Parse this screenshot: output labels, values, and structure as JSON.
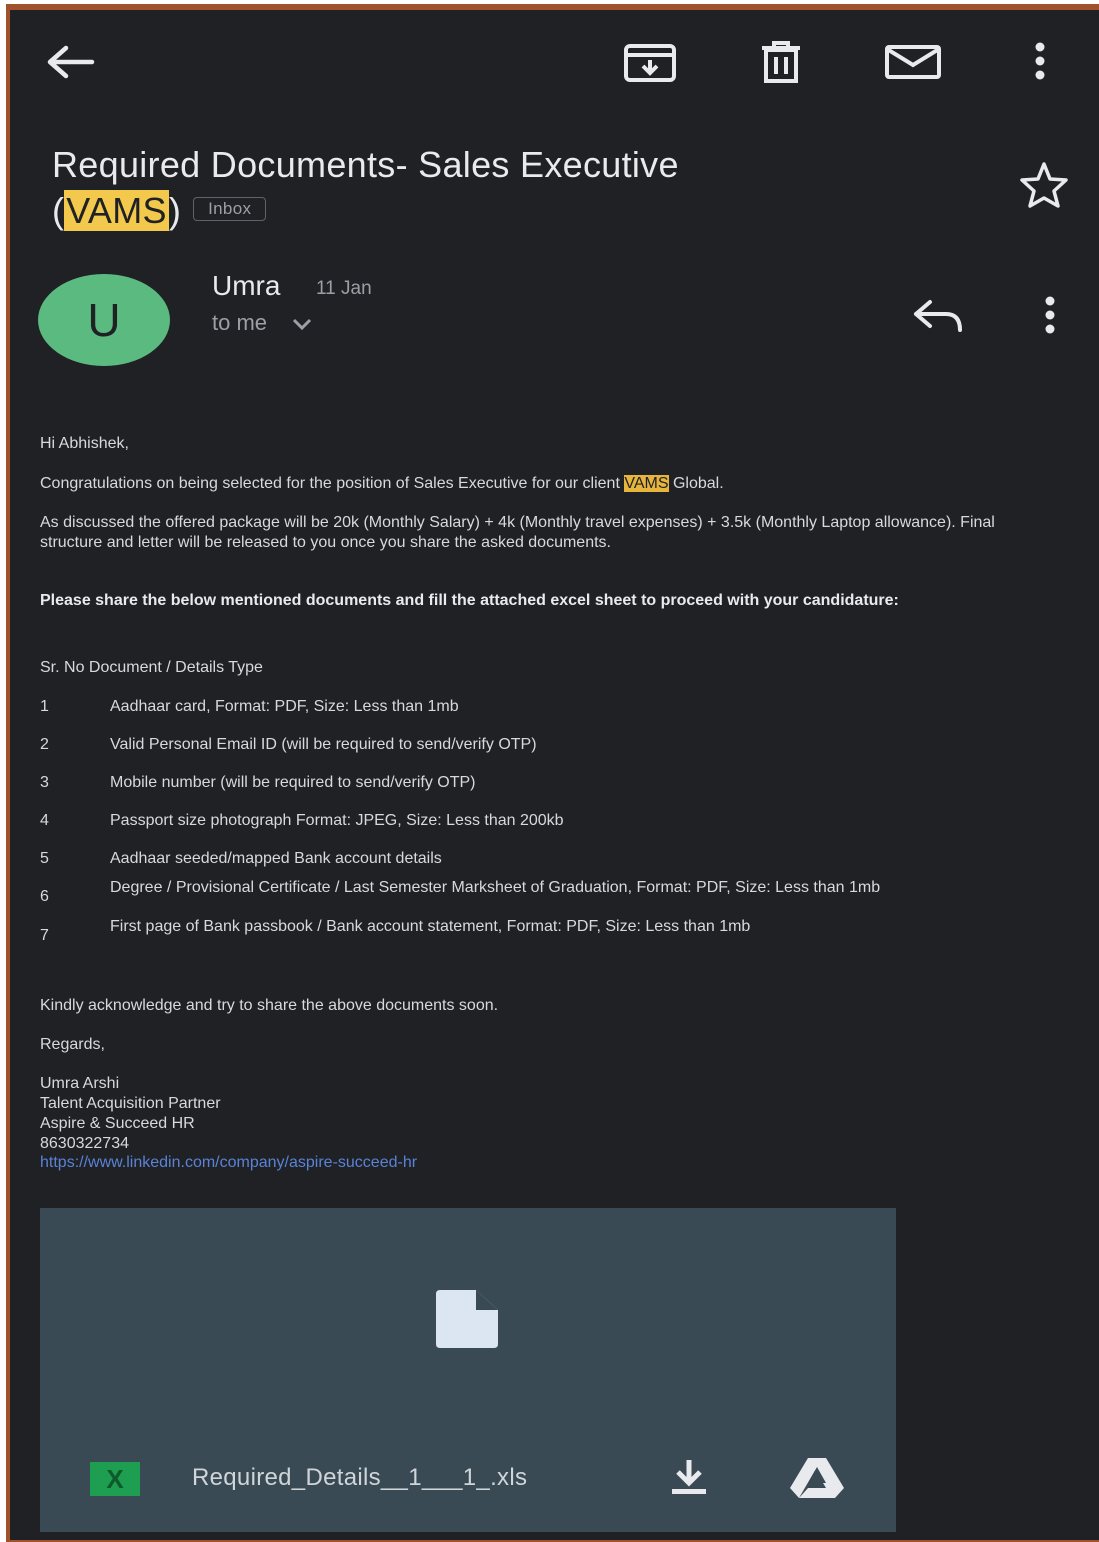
{
  "toolbar": {
    "back_icon": "arrow-left-icon",
    "archive_icon": "archive-icon",
    "delete_icon": "trash-icon",
    "mark_unread_icon": "mail-icon",
    "more_icon": "more-vert-icon"
  },
  "email": {
    "subject_line1": "Required Documents- Sales Executive",
    "subject_paren_open": "(",
    "subject_highlight": "VAMS",
    "subject_paren_close": ")",
    "label": "Inbox",
    "sender_initial": "U",
    "sender_name": "Umra",
    "date": "11 Jan",
    "recipient": "to me",
    "avatar_color": "#5bba7f"
  },
  "body": {
    "greeting": "Hi Abhishek,",
    "congrats_pre": "Congratulations on being selected for the position of Sales Executive for our client ",
    "congrats_highlight": "VAMS",
    "congrats_post": " Global.",
    "package": "As discussed the offered package will be 20k (Monthly Salary) + 4k (Monthly travel expenses) + 3.5k (Monthly Laptop allowance). Final structure and letter will be released to you once you share the asked documents.",
    "request": "Please share the below mentioned documents and fill the attached excel sheet to proceed with your candidature:",
    "table_header": "Sr. No Document / Details Type",
    "documents": [
      {
        "no": "1",
        "text": "Aadhaar card, Format: PDF, Size: Less than 1mb"
      },
      {
        "no": "2",
        "text": "Valid Personal Email ID (will be required to send/verify OTP)"
      },
      {
        "no": "3",
        "text": "Mobile number (will be required to send/verify OTP)"
      },
      {
        "no": "4",
        "text": "Passport size photograph Format: JPEG, Size: Less than 200kb"
      },
      {
        "no": "5",
        "text": "Aadhaar seeded/mapped Bank account details"
      },
      {
        "no": "6",
        "text": "Degree / Provisional Certificate / Last Semester Marksheet of Graduation, Format: PDF, Size: Less than 1mb"
      },
      {
        "no": "7",
        "text": "First page of Bank passbook / Bank account statement, Format: PDF, Size: Less than 1mb"
      }
    ],
    "closing": "Kindly acknowledge and try to share the above documents soon.",
    "regards": "Regards,",
    "sig_name": "Umra Arshi",
    "sig_title": "Talent Acquisition Partner",
    "sig_company": "Aspire & Succeed HR",
    "sig_phone": "8630322734",
    "sig_link": "https://www.linkedin.com/company/aspire-succeed-hr"
  },
  "attachment": {
    "file_type_icon": "excel-icon",
    "file_type_letter": "X",
    "filename": "Required_Details__1___1_.xls",
    "preview_icon": "document-icon",
    "download_icon": "download-icon",
    "drive_icon": "google-drive-icon"
  }
}
